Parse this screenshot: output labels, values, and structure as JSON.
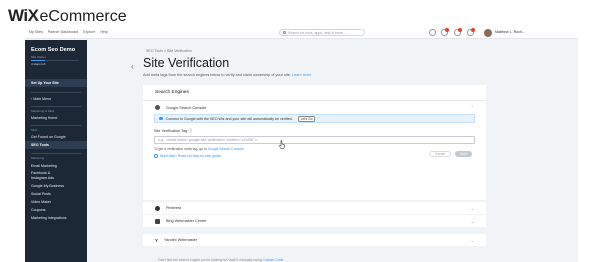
{
  "brand": {
    "wix": "WiX",
    "ecommerce": "eCommerce"
  },
  "topbar": {
    "menu": [
      "My Sites",
      "Partner Dashboard",
      "Explore",
      "Help"
    ],
    "search_placeholder": "Search for tools, apps, help & more...",
    "user_name": "Matthew L. Roch..."
  },
  "sidebar": {
    "site_name": "Ecom Seo Demo",
    "site_sub": "Site Owner",
    "progress": 0.3,
    "progress_text": "4 steps left",
    "setup": "Set Up Your Site",
    "main_menu": "Main Menu",
    "sec_marketing": "Marketing & SEO",
    "marketing_home": "Marketing Home",
    "sec_seo": "SEO",
    "get_found": "Get Found on Google",
    "seo_tools": "SEO Tools",
    "sec_marketing2": "Marketing",
    "items": [
      "Email Marketing",
      "Facebook &",
      "Instagram Ads",
      "Google My Business",
      "Social Posts",
      "Video Maker",
      "Coupons",
      "Marketing Integrations"
    ]
  },
  "page": {
    "breadcrumb": "SEO Tools  >  Site Verification",
    "title": "Site Verification",
    "description": "Add meta tags from the search engines below to verify and claim ownership of your site.",
    "learn_more": "Learn more"
  },
  "engines": {
    "header": "Search Engines",
    "google": "Google Search Console",
    "connect_text": "Connect to Google with the SEO Wiz and your site will automatically be verified.",
    "connect_btn": "Let's Go",
    "field_label": "Site Verification Tag",
    "field_placeholder": "e.g., <meta name='google-site-verification' content='123456' />",
    "helper": "To get a verification meta tag, go to",
    "helper_link": "Google Search Console.",
    "need_help": "Need help? Read our step-by-step guide",
    "cancel": "Cancel",
    "save": "Save",
    "pinterest": "Pinterest",
    "bing": "Bing Webmaster Center",
    "yandex": "Yandex Webmaster"
  },
  "bottom": {
    "text": "Can't find the search engine you're looking for? Add it manually using",
    "link": "Custom Code"
  },
  "colors": {
    "sidebar": "#1c2836",
    "accent": "#3899ec",
    "app_bg": "#f0f4f7"
  }
}
